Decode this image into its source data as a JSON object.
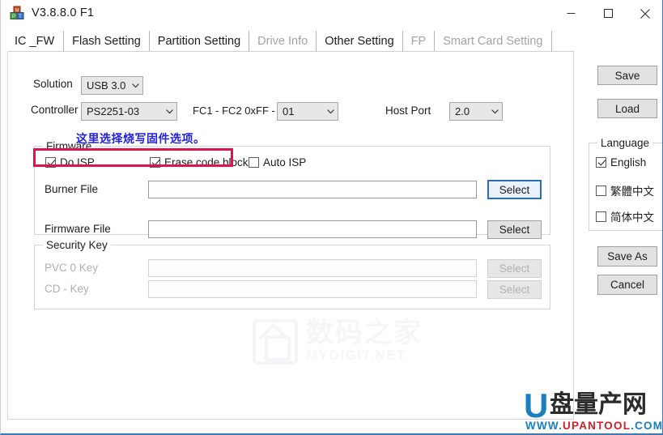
{
  "window": {
    "title": "V3.8.8.0 F1",
    "icon": "app-blocks-icon",
    "minimize_label": "Minimize",
    "maximize_label": "Maximize",
    "close_label": "Close",
    "accent_color": "#3a7bbf"
  },
  "tabs": [
    {
      "label": "IC _FW",
      "active": true,
      "disabled": false
    },
    {
      "label": "Flash Setting",
      "active": false,
      "disabled": false
    },
    {
      "label": "Partition Setting",
      "active": false,
      "disabled": false
    },
    {
      "label": "Drive Info",
      "active": false,
      "disabled": true
    },
    {
      "label": "Other Setting",
      "active": false,
      "disabled": false
    },
    {
      "label": "FP",
      "active": false,
      "disabled": true
    },
    {
      "label": "Smart Card Setting",
      "active": false,
      "disabled": true
    }
  ],
  "main": {
    "solution": {
      "label": "Solution",
      "value": "USB 3.0"
    },
    "controller": {
      "label": "Controller",
      "value": "PS2251-03"
    },
    "fc_range": {
      "label": "FC1 - FC2   0xFF -",
      "value": "01"
    },
    "host_port": {
      "label": "Host Port",
      "value": "2.0"
    },
    "firmware_group": {
      "title": "Firmware",
      "checkboxes": [
        {
          "label": "Do ISP",
          "checked": true
        },
        {
          "label": "Erase code block",
          "checked": true
        },
        {
          "label": "Auto ISP",
          "checked": false
        }
      ],
      "burner_file": {
        "label": "Burner File",
        "value": "",
        "button": "Select",
        "button_focused": true
      },
      "firmware_file": {
        "label": "Firmware File",
        "value": "",
        "button": "Select",
        "button_focused": false
      }
    },
    "security_group": {
      "title": "Security Key",
      "pvc_key": {
        "label": "PVC 0 Key",
        "value": "",
        "button": "Select",
        "disabled": true
      },
      "cd_key": {
        "label": "CD - Key",
        "value": "",
        "button": "Select",
        "disabled": true
      }
    }
  },
  "sidebar": {
    "save_button": "Save",
    "load_button": "Load",
    "language_group": {
      "title": "Language",
      "options": [
        {
          "label": "English",
          "checked": true
        },
        {
          "label": "繁體中文",
          "checked": false
        },
        {
          "label": "简体中文",
          "checked": false
        }
      ]
    },
    "save_as_button": "Save As",
    "cancel_button": "Cancel"
  },
  "annotations": {
    "text": "这里选择烧写固件选项。",
    "text_color": "#2222dd",
    "highlight_color": "#e0144c"
  },
  "watermarks": {
    "center": {
      "cn": "数码之家",
      "en": "MYDIGIT.NET"
    },
    "bottom_right": {
      "logo_letter": "U",
      "cn": "盘量产网",
      "url_www": "WWW.",
      "url_name": "UPANTOOL",
      "url_tld": ".COM"
    }
  }
}
